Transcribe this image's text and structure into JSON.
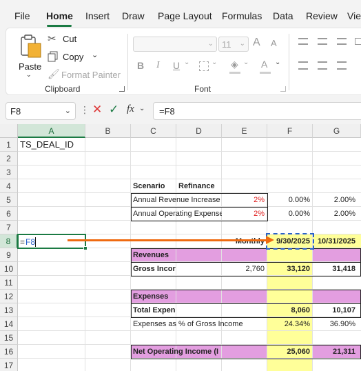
{
  "ribbon_tabs": [
    "File",
    "Home",
    "Insert",
    "Draw",
    "Page Layout",
    "Formulas",
    "Data",
    "Review",
    "View"
  ],
  "active_tab": "Home",
  "clipboard": {
    "paste": "Paste",
    "cut": "Cut",
    "copy": "Copy",
    "format_painter": "Format Painter",
    "group_label": "Clipboard"
  },
  "font": {
    "size": "11",
    "group_label": "Font",
    "grow": "A",
    "shrink": "A",
    "bold": "B",
    "italic": "I",
    "underline": "U",
    "font_color": "A"
  },
  "formula_bar": {
    "name_box": "F8",
    "fx": "fx",
    "formula": "=F8"
  },
  "columns": [
    "A",
    "B",
    "C",
    "D",
    "E",
    "F",
    "G"
  ],
  "rows": [
    "1",
    "2",
    "3",
    "4",
    "5",
    "6",
    "7",
    "8",
    "9",
    "10",
    "11",
    "12",
    "13",
    "14",
    "15",
    "16",
    "17"
  ],
  "sheet": {
    "a1": "TS_DEAL_ID",
    "scenario_label": "Scenario",
    "scenario_value": "Refinance",
    "rev_increase_label": "Annual Revenue Increase",
    "rev_increase_e": "2%",
    "rev_increase_f": "0.00%",
    "rev_increase_g": "2.00%",
    "opex_label": "Annual Operating Expense",
    "opex_e": "2%",
    "opex_f": "0.00%",
    "opex_g": "2.00%",
    "a8_prefix": "=",
    "a8_ref": "F8",
    "monthly": "Monthly",
    "date_f": "9/30/2025",
    "date_g": "10/31/2025",
    "revenues": "Revenues",
    "gross_income_label": "Gross Incor",
    "gross_income_e": "2,760",
    "gross_income_f": "33,120",
    "gross_income_g": "31,418",
    "expenses": "Expenses",
    "total_exp_label": "Total Expen",
    "total_exp_f": "8,060",
    "total_exp_g": "10,107",
    "exp_pct_label": "Expenses as % of Gross Income",
    "exp_pct_f": "24.34%",
    "exp_pct_g": "36.90%",
    "noi_label": "Net Operating Income (I",
    "noi_f": "25,060",
    "noi_g": "21,311"
  },
  "colors": {
    "accent": "#1b7a43",
    "highlight_yellow": "#ffff99",
    "section_pink": "#e39ee0",
    "arrow": "#ef6a10",
    "negative_red": "#e02020"
  }
}
